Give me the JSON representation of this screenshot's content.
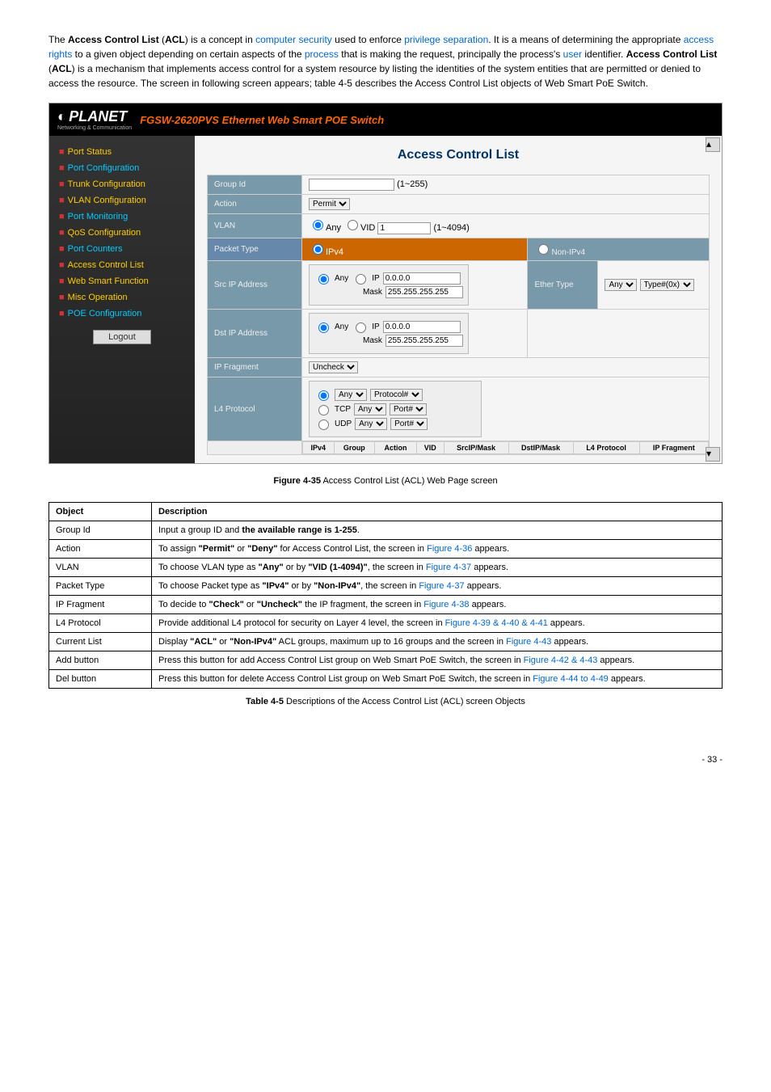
{
  "intro": {
    "p1_start": "The ",
    "acl_bold": "Access Control List",
    "p1_paren1": " (",
    "acl_abbr": "ACL",
    "p1_paren2": ") is a concept in ",
    "link_security": "computer security",
    "p1_mid1": " used to enforce ",
    "link_privsep": "privilege separation",
    "p1_mid2": ". It is a means of determining the appropriate ",
    "link_access": "access rights",
    "p1_mid3": " to a given object depending on certain aspects of the ",
    "link_process": "process",
    "p1_mid4": " that is making the request, principally the process's ",
    "link_user": "user",
    "p1_mid5": " identifier. ",
    "acl_bold2": "Access Control List",
    "p1_paren3": " (",
    "acl_abbr2": "ACL",
    "p1_paren4": ") is a mechanism that implements access control for a system resource by listing the identities of the system entities that are permitted or denied to access the resource. The screen in following screen appears; table 4-5 describes the Access Control List objects of Web Smart PoE Switch."
  },
  "app": {
    "logo": "PLANET",
    "logo_sub": "Networking & Communication",
    "title": "FGSW-2620PVS Ethernet Web Smart POE Switch"
  },
  "sidebar": [
    {
      "label": "Port Status",
      "cls": "yellow"
    },
    {
      "label": "Port Configuration",
      "cls": "blue"
    },
    {
      "label": "Trunk Configuration",
      "cls": "yellow"
    },
    {
      "label": "VLAN Configuration",
      "cls": "yellow"
    },
    {
      "label": "Port Monitoring",
      "cls": "blue"
    },
    {
      "label": "QoS Configuration",
      "cls": "yellow"
    },
    {
      "label": "Port Counters",
      "cls": "blue"
    },
    {
      "label": "Access Control List",
      "cls": "yellow"
    },
    {
      "label": "Web Smart Function",
      "cls": "yellow"
    },
    {
      "label": "Misc Operation",
      "cls": "yellow"
    },
    {
      "label": "POE Configuration",
      "cls": "blue"
    }
  ],
  "logout": "Logout",
  "main": {
    "title": "Access Control List",
    "rows": {
      "group_id": {
        "label": "Group Id",
        "value": "",
        "hint": "(1~255)"
      },
      "action": {
        "label": "Action",
        "value": "Permit"
      },
      "vlan": {
        "label": "VLAN",
        "any": "Any",
        "vid": "VID",
        "vid_val": "1",
        "hint": "(1~4094)"
      },
      "packet_type": {
        "label": "Packet Type",
        "ipv4": "IPv4",
        "nonipv4": "Non-IPv4"
      },
      "src_ip": {
        "label": "Src IP Address",
        "any": "Any",
        "ip": "IP",
        "ip_val": "0.0.0.0",
        "mask": "Mask",
        "mask_val": "255.255.255.255"
      },
      "ether_type": {
        "label": "Ether Type",
        "any": "Any",
        "typehex": "Type#(0x)"
      },
      "dst_ip": {
        "label": "Dst IP Address",
        "any": "Any",
        "ip": "IP",
        "ip_val": "0.0.0.0",
        "mask": "Mask",
        "mask_val": "255.255.255.255"
      },
      "ip_fragment": {
        "label": "IP Fragment",
        "value": "Uncheck"
      },
      "l4_protocol": {
        "label": "L4 Protocol",
        "any": "Any",
        "proto": "Protocol#",
        "tcp": "TCP",
        "tcp_val": "Any",
        "tcp_port": "Port#",
        "udp": "UDP",
        "udp_val": "Any",
        "udp_port": "Port#"
      }
    },
    "bottom_headers": [
      "IPv4",
      "Group",
      "Action",
      "VID",
      "SrcIP/Mask",
      "DstIP/Mask",
      "L4 Protocol",
      "IP Fragment"
    ]
  },
  "fig_caption": "Figure 4-35",
  "fig_caption_text": " Access Control List (ACL) Web Page screen",
  "desc_table": {
    "headers": [
      "Object",
      "Description"
    ],
    "rows": [
      {
        "obj": "Group Id",
        "pre": "Input a group ID and ",
        "b1": "the available range is 1-255",
        "post": "."
      },
      {
        "obj": "Action",
        "pre": "To assign ",
        "b1": "\"Permit\"",
        "mid1": " or ",
        "b2": "\"Deny\"",
        "mid2": " for Access Control List, the screen in ",
        "link": "Figure 4-36",
        "post": " appears."
      },
      {
        "obj": "VLAN",
        "pre": "To choose VLAN type as ",
        "b1": "\"Any\"",
        "mid1": " or by ",
        "b2": "\"VID (1-4094)\"",
        "mid2": ", the screen in ",
        "link": "Figure 4-37",
        "post": " appears."
      },
      {
        "obj": "Packet Type",
        "pre": "To choose Packet type as ",
        "b1": "\"IPv4\"",
        "mid1": " or by ",
        "b2": "\"Non-IPv4\"",
        "mid2": ", the screen in ",
        "link": "Figure 4-37",
        "post": " appears."
      },
      {
        "obj": "IP Fragment",
        "pre": "To decide to ",
        "b1": "\"Check\"",
        "mid1": " or ",
        "b2": "\"Uncheck\"",
        "mid2": " the IP fragment, the screen in ",
        "link": "Figure 4-38",
        "post": " appears."
      },
      {
        "obj": "L4 Protocol",
        "pre": "Provide additional L4 protocol for security on Layer 4 level, the screen in ",
        "link": "Figure 4-39 & 4-40 & 4-41",
        "post": " appears."
      },
      {
        "obj": "Current List",
        "pre": "Display ",
        "b1": "\"ACL\"",
        "mid1": " or ",
        "b2": "\"Non-IPv4\"",
        "mid2": " ACL groups, maximum up to 16 groups and the screen in ",
        "link": "Figure 4-43",
        "post": " appears."
      },
      {
        "obj": "Add button",
        "pre": "Press this button for add Access Control List group on Web Smart PoE Switch, the screen in ",
        "link": "Figure 4-42 & 4-43",
        "post": " appears."
      },
      {
        "obj": "Del button",
        "pre": "Press this button for delete Access Control List group on Web Smart PoE Switch, the screen in ",
        "link": "Figure 4-44 to 4-49",
        "post": " appears."
      }
    ]
  },
  "table_caption": "Table 4-5",
  "table_caption_text": " Descriptions of the Access Control List (ACL) screen Objects",
  "page_num": "- 33 -"
}
